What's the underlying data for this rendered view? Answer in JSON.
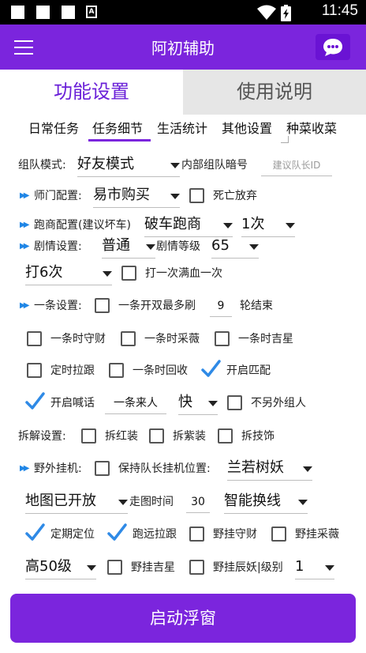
{
  "status_bar": {
    "time": "11:45",
    "notification_badge": "A",
    "icons": [
      "square-icon",
      "square-icon",
      "square-icon",
      "a-icon",
      "wifi-icon",
      "battery-charging-icon"
    ]
  },
  "app_bar": {
    "title": "阿初辅助",
    "menu_icon": "menu-icon",
    "chat_icon": "chat-bubble-icon"
  },
  "main_tabs": [
    {
      "label": "功能设置",
      "selected": true
    },
    {
      "label": "使用说明",
      "selected": false
    }
  ],
  "sub_tabs": [
    {
      "label": "日常任务",
      "selected": false
    },
    {
      "label": "任务细节",
      "selected": true
    },
    {
      "label": "生活统计",
      "selected": false
    },
    {
      "label": "其他设置",
      "selected": false
    },
    {
      "label": "种菜收菜",
      "selected": false
    }
  ],
  "team": {
    "mode_label": "组队模式:",
    "mode_value": "好友模式",
    "code_label": "内部组队暗号",
    "code_placeholder": "建议队长ID"
  },
  "master": {
    "label": "师门配置:",
    "value": "易市购买",
    "death_label": "死亡放弃",
    "death_checked": false
  },
  "run": {
    "label": "跑商配置(建议坏车)",
    "car_value": "破车跑商",
    "times_value": "1次"
  },
  "story": {
    "label": "剧情设置:",
    "value": "普通",
    "level_label": "剧情等级",
    "level_value": "65",
    "hit_value": "打6次",
    "hit_once_label": "打一次满血一次",
    "hit_once_checked": false
  },
  "yitiao": {
    "label": "一条设置:",
    "double_label": "一条开双最多刷",
    "double_checked": false,
    "rounds_value": "9",
    "rounds_suffix": "轮结束",
    "guard_label": "一条时守财",
    "guard_checked": false,
    "gather_label": "一条时采薇",
    "gather_checked": false,
    "lucky_label": "一条时吉星",
    "lucky_checked": false,
    "follow_label": "定时拉跟",
    "follow_checked": false,
    "recycle_label": "一条时回收",
    "recycle_checked": false,
    "match_label": "开启匹配",
    "match_checked": true,
    "shout_label": "开启喊话",
    "shout_checked": true,
    "shout_text": "一条来人",
    "speed_value": "快",
    "no_other_label": "不另外组人",
    "no_other_checked": false
  },
  "dismantle": {
    "label": "拆解设置:",
    "red_label": "拆红装",
    "red_checked": false,
    "purple_label": "拆紫装",
    "purple_checked": false,
    "jewel_label": "拆技饰",
    "jewel_checked": false
  },
  "wild": {
    "label": "野外挂机:",
    "keep_label": "保持队长挂机位置:",
    "keep_checked": false,
    "place_value": "兰若树妖",
    "map_value": "地图已开放",
    "walk_label": "走图时间",
    "walk_value": "30",
    "line_value": "智能换线",
    "locate_label": "定期定位",
    "locate_checked": true,
    "far_follow_label": "跑远拉跟",
    "far_follow_checked": true,
    "wild_guard_label": "野挂守财",
    "wild_guard_checked": false,
    "wild_gather_label": "野挂采薇",
    "wild_gather_checked": false,
    "grade_value": "高50级",
    "wild_lucky_label": "野挂吉星",
    "wild_lucky_checked": false,
    "chen_label": "野挂辰妖|级别",
    "chen_checked": false,
    "chen_value": "1"
  },
  "start_button": "启动浮窗",
  "colors": {
    "accent": "#7b25dd",
    "check": "#2f8ae6",
    "arrow": "#1f86e6",
    "tab_inactive_bg": "#e6e6e6"
  }
}
